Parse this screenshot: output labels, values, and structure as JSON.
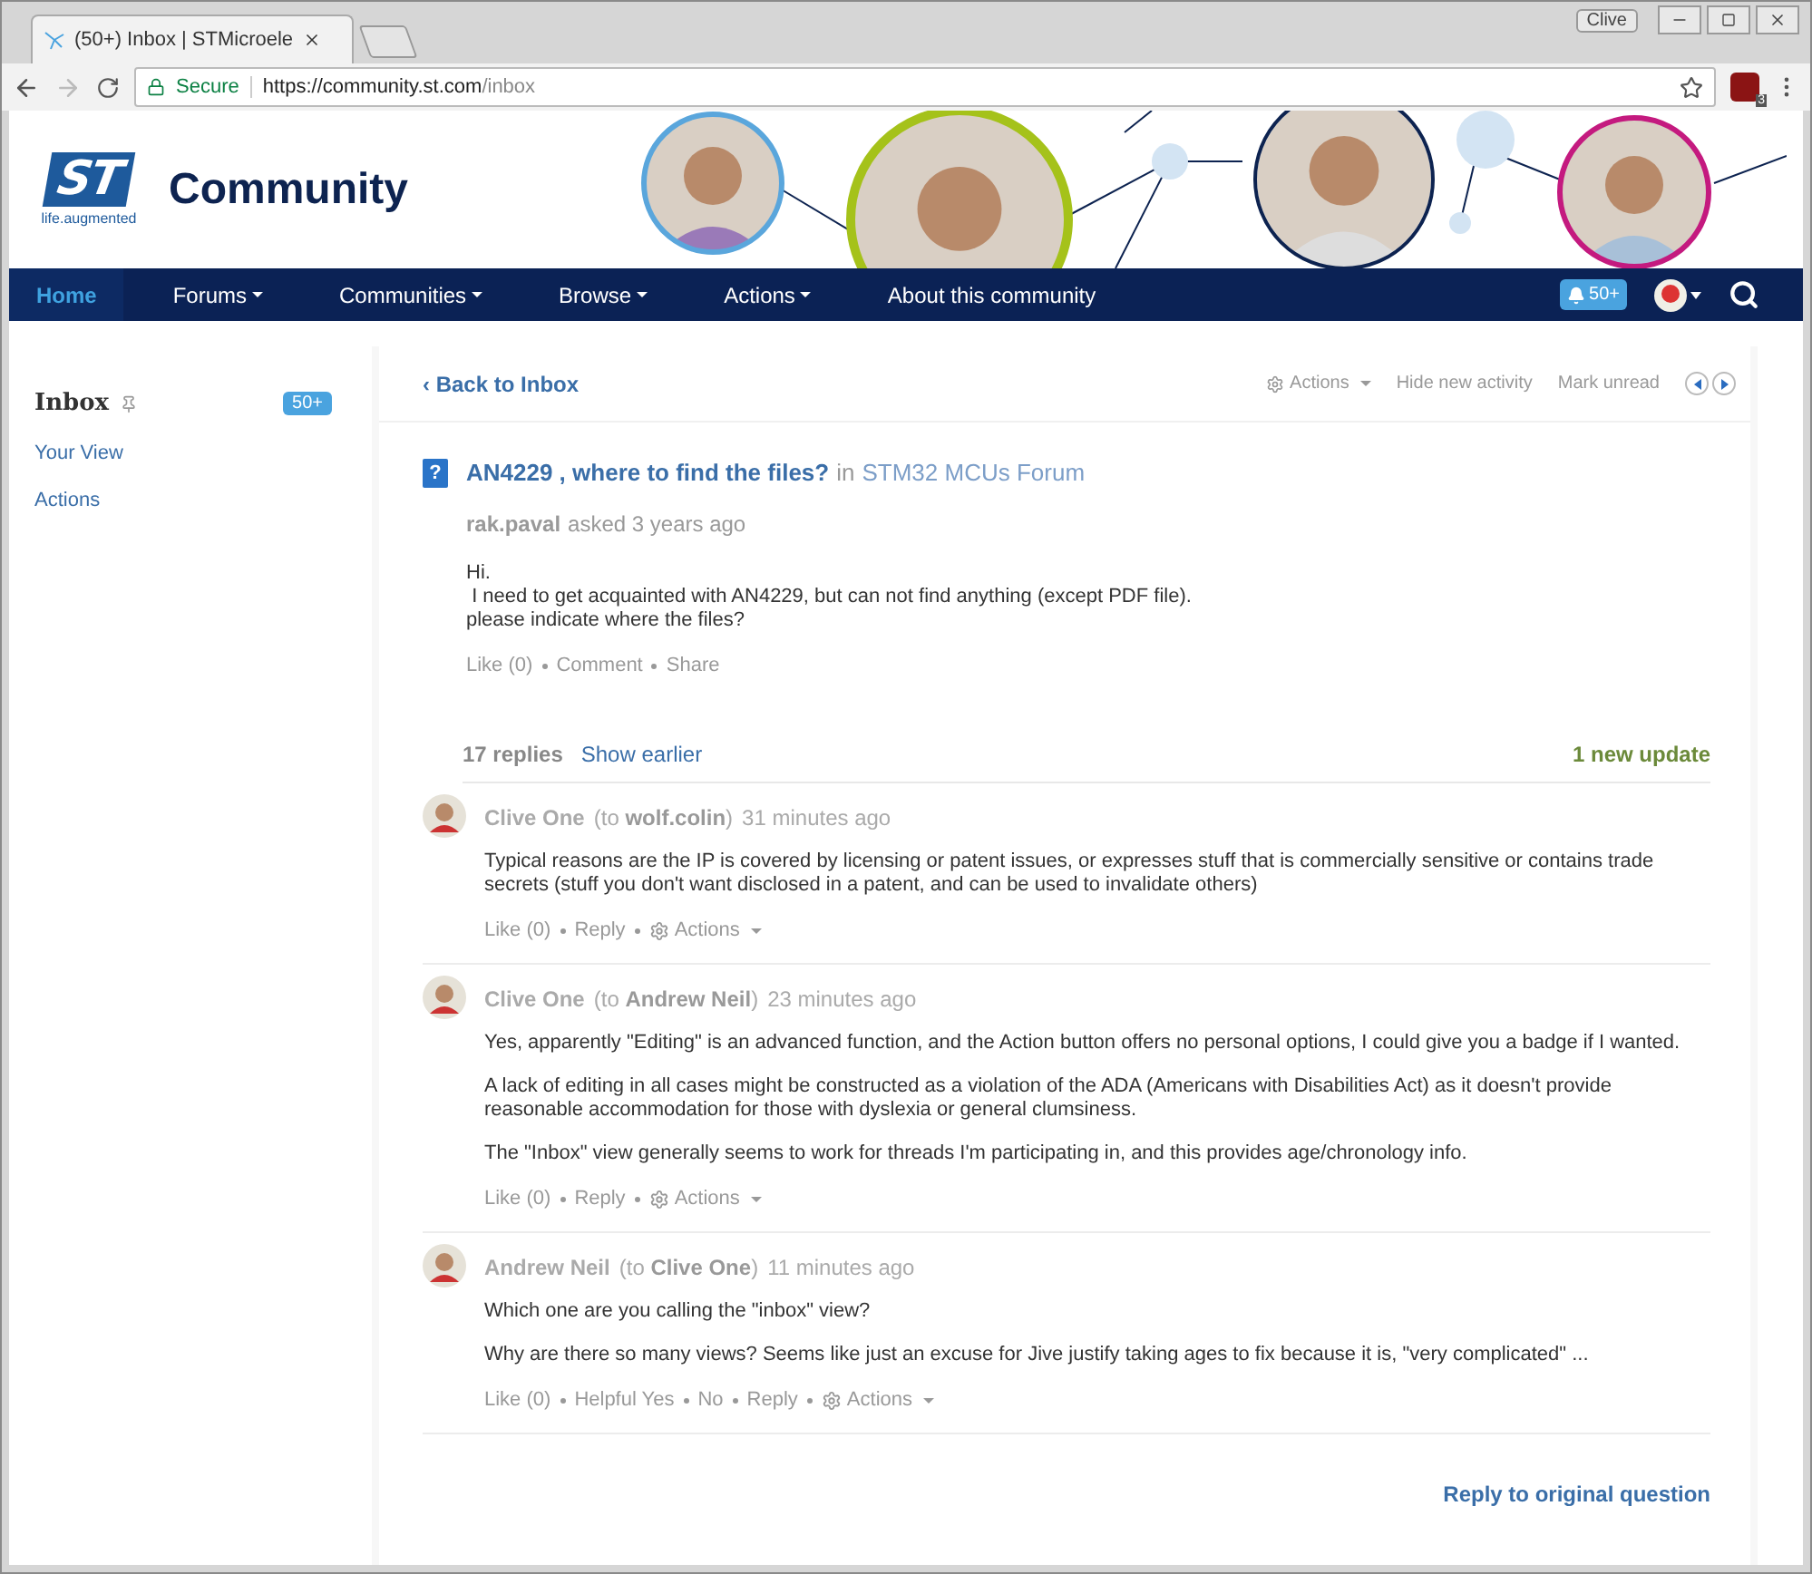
{
  "browser": {
    "tab_title": "(50+) Inbox | STMicroele",
    "profile": "Clive",
    "secure_label": "Secure",
    "url_host": "https://community.st.com",
    "url_path": "/inbox",
    "extension_badge": "3"
  },
  "header": {
    "logo_text": "ST",
    "tagline": "life.augmented",
    "title": "Community"
  },
  "nav": {
    "items": [
      {
        "label": "Home",
        "selected": true,
        "dropdown": false
      },
      {
        "label": "Forums",
        "selected": false,
        "dropdown": true
      },
      {
        "label": "Communities",
        "selected": false,
        "dropdown": true
      },
      {
        "label": "Browse",
        "selected": false,
        "dropdown": true
      },
      {
        "label": "Actions",
        "selected": false,
        "dropdown": true
      },
      {
        "label": "About this community",
        "selected": false,
        "dropdown": false
      }
    ],
    "notifications": "50+"
  },
  "sidebar": {
    "title": "Inbox",
    "count": "50+",
    "items": [
      "Your View",
      "Actions"
    ]
  },
  "toolbar": {
    "back_glyph": "‹",
    "back": "Back to Inbox",
    "actions": "Actions",
    "links": [
      "Hide new activity",
      "Mark unread"
    ]
  },
  "question": {
    "icon_glyph": "?",
    "title": "AN4229 , where to find the files?",
    "in_word": "in",
    "forum": "STM32 MCUs Forum",
    "author": "rak.paval",
    "asked": "asked 3 years ago",
    "body": [
      "Hi.",
      "I need to get acquainted with AN4229, but can not find anything (except PDF file).",
      "please indicate where the files?"
    ],
    "actions": [
      "Like (0)",
      "Comment",
      "Share"
    ]
  },
  "replies_header": {
    "count": "17 replies",
    "show_earlier": "Show earlier",
    "new_update": "1 new update"
  },
  "replies": [
    {
      "author": "Clive One",
      "recipient": "(to **wolf.colin**)",
      "time": "31 minutes ago",
      "paragraphs": [
        "Typical reasons are the IP is covered by licensing or patent issues, or expresses stuff that is commercially sensitive or contains trade secrets (stuff you don't want disclosed in a patent, and can be used to invalidate others)"
      ],
      "actions": [
        {
          "kind": "link",
          "label": "Like (0)"
        },
        {
          "kind": "link",
          "label": "Reply"
        },
        {
          "kind": "menu",
          "label": "Actions"
        }
      ]
    },
    {
      "author": "Clive One",
      "recipient": "(to **Andrew Neil**)",
      "time": "23 minutes ago",
      "paragraphs": [
        "Yes, apparently \"Editing\" is an advanced function, and the Action button offers no personal options, I could give you a badge if I wanted.",
        "A lack of editing in all cases might be constructed as a violation of the ADA (Americans with Disabilities Act) as it doesn't provide reasonable accommodation for those with dyslexia or general clumsiness.",
        "The \"Inbox\" view generally seems to work for threads I'm participating in, and this provides age/chronology info."
      ],
      "actions": [
        {
          "kind": "link",
          "label": "Like (0)"
        },
        {
          "kind": "link",
          "label": "Reply"
        },
        {
          "kind": "menu",
          "label": "Actions"
        }
      ]
    },
    {
      "author": "Andrew Neil",
      "recipient": "(to **Clive One**)",
      "time": "11 minutes ago",
      "paragraphs": [
        "Which one are you calling the \"inbox\" view?",
        "Why are there so many views? Seems like just an excuse for Jive justify taking ages to fix because it is, \"very complicated\" ..."
      ],
      "actions": [
        {
          "kind": "link",
          "label": "Like (0)"
        },
        {
          "kind": "link",
          "label": "Helpful Yes"
        },
        {
          "kind": "link",
          "label": "No"
        },
        {
          "kind": "link",
          "label": "Reply"
        },
        {
          "kind": "menu",
          "label": "Actions"
        }
      ]
    }
  ],
  "reply_link": "Reply to original question"
}
